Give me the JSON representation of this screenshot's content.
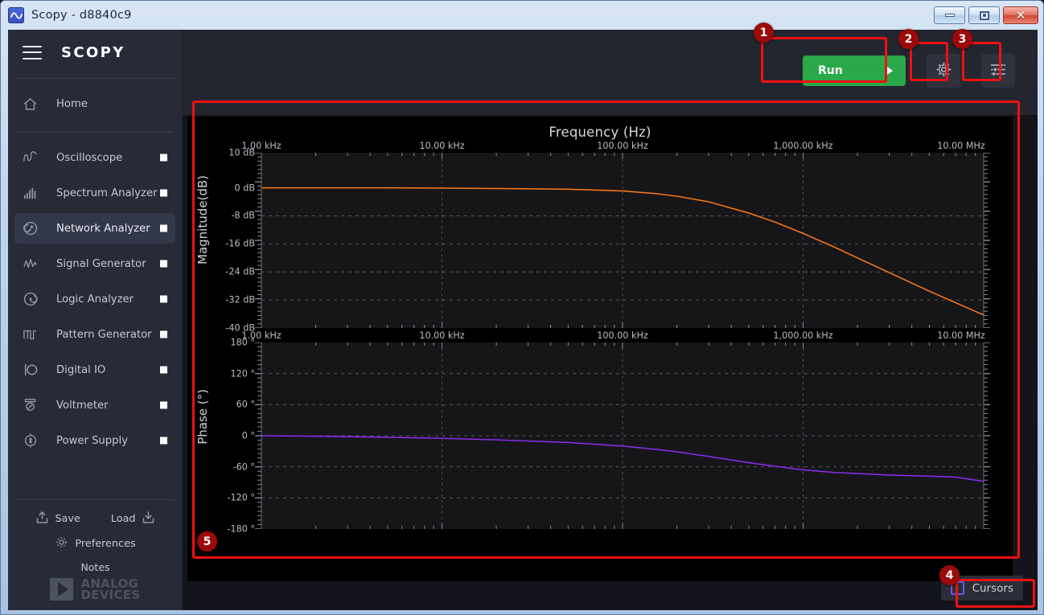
{
  "window": {
    "title": "Scopy - d8840c9",
    "icon": "waveform-icon",
    "controls": {
      "minimize": "minimize-icon",
      "maximize": "maximize-icon",
      "close": "close-icon"
    }
  },
  "sidebar": {
    "logo": "SCOPY",
    "menu_icon": "hamburger-icon",
    "home": {
      "label": "Home",
      "icon": "home-icon"
    },
    "items": [
      {
        "label": "Oscilloscope",
        "icon": "oscilloscope-icon",
        "active": false,
        "toggle": true
      },
      {
        "label": "Spectrum Analyzer",
        "icon": "spectrum-analyzer-icon",
        "active": false,
        "toggle": true
      },
      {
        "label": "Network Analyzer",
        "icon": "network-analyzer-icon",
        "active": true,
        "toggle": true
      },
      {
        "label": "Signal Generator",
        "icon": "signal-generator-icon",
        "active": false,
        "toggle": true
      },
      {
        "label": "Logic Analyzer",
        "icon": "logic-analyzer-icon",
        "active": false,
        "toggle": true
      },
      {
        "label": "Pattern Generator",
        "icon": "pattern-generator-icon",
        "active": false,
        "toggle": true
      },
      {
        "label": "Digital IO",
        "icon": "digital-io-icon",
        "active": false,
        "toggle": true
      },
      {
        "label": "Voltmeter",
        "icon": "voltmeter-icon",
        "active": false,
        "toggle": true
      },
      {
        "label": "Power Supply",
        "icon": "power-supply-icon",
        "active": false,
        "toggle": true
      }
    ],
    "footer": {
      "save": "Save",
      "load": "Load",
      "preferences": "Preferences",
      "notes": "Notes",
      "brand_line1": "ANALOG",
      "brand_line2": "DEVICES"
    }
  },
  "toolbar": {
    "run_label": "Run",
    "run_color": "#2aa84a",
    "settings_icon": "gear-icon",
    "preferences_icon": "sliders-icon"
  },
  "cursors": {
    "label": "Cursors",
    "checked": false,
    "accent": "#5a5fe8"
  },
  "annotations": [
    {
      "number": "1",
      "target": "run-button"
    },
    {
      "number": "2",
      "target": "settings-button"
    },
    {
      "number": "3",
      "target": "sliders-button"
    },
    {
      "number": "4",
      "target": "cursors-toggle"
    },
    {
      "number": "5",
      "target": "plot-panel"
    }
  ],
  "chart_data": [
    {
      "type": "line",
      "title": "Frequency (Hz)",
      "xlabel": "Frequency (Hz)",
      "ylabel": "Magnitude(dB)",
      "xscale": "log",
      "xlim": [
        1000,
        10000000
      ],
      "ylim": [
        -40,
        10
      ],
      "xticks": [
        "1.00 kHz",
        "10.00 kHz",
        "100.00 kHz",
        "1,000.00 kHz",
        "10.00 MHz"
      ],
      "xtick_values": [
        1000,
        10000,
        100000,
        1000000,
        10000000
      ],
      "yticks": [
        "10 dB",
        "0 dB",
        "-8 dB",
        "-16 dB",
        "-24 dB",
        "-32 dB",
        "-40 dB"
      ],
      "ytick_values": [
        10,
        0,
        -8,
        -16,
        -24,
        -32,
        -40
      ],
      "grid": true,
      "legend": "none",
      "series": [
        {
          "name": "Magnitude",
          "color": "#ff7a1a",
          "x": [
            1000,
            2000,
            5000,
            10000,
            20000,
            50000,
            100000,
            150000,
            200000,
            300000,
            500000,
            700000,
            1000000,
            1500000,
            2000000,
            3000000,
            5000000,
            7000000,
            10000000
          ],
          "values": [
            0,
            0,
            0,
            -0.1,
            -0.2,
            -0.4,
            -0.9,
            -1.6,
            -2.4,
            -4.0,
            -7.2,
            -9.8,
            -13.0,
            -17.0,
            -20.0,
            -24.2,
            -29.5,
            -32.8,
            -36.3
          ]
        }
      ]
    },
    {
      "type": "line",
      "title": "",
      "xlabel": "Frequency (Hz)",
      "ylabel": "Phase (°)",
      "xscale": "log",
      "xlim": [
        1000,
        10000000
      ],
      "ylim": [
        -180,
        180
      ],
      "xticks": [
        "1.00 kHz",
        "10.00 kHz",
        "100.00 kHz",
        "1,000.00 kHz",
        "10.00 MHz"
      ],
      "xtick_values": [
        1000,
        10000,
        100000,
        1000000,
        10000000
      ],
      "yticks": [
        "180 °",
        "120 °",
        "60 °",
        "0 °",
        "-60 °",
        "-120 °",
        "-180 °"
      ],
      "ytick_values": [
        180,
        120,
        60,
        0,
        -60,
        -120,
        -180
      ],
      "grid": true,
      "legend": "none",
      "series": [
        {
          "name": "Phase",
          "color": "#8c2bf0",
          "x": [
            1000,
            2000,
            5000,
            10000,
            20000,
            50000,
            100000,
            150000,
            200000,
            300000,
            500000,
            700000,
            1000000,
            1500000,
            2000000,
            3000000,
            5000000,
            7000000,
            10000000
          ],
          "values": [
            0,
            -1,
            -3,
            -5,
            -8,
            -13,
            -20,
            -26,
            -31,
            -40,
            -52,
            -59,
            -66,
            -71,
            -73,
            -76,
            -78,
            -80,
            -88
          ]
        }
      ]
    }
  ]
}
